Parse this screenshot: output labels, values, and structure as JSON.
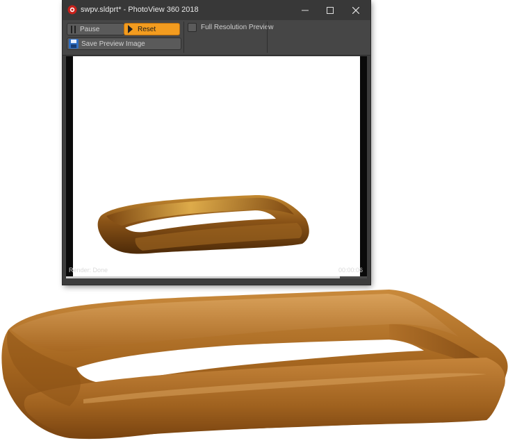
{
  "window": {
    "title": "swpv.sldprt* - PhotoView 360 2018",
    "icon": "photoview-app-icon",
    "controls": {
      "minimize": "minimize-icon",
      "maximize": "maximize-icon",
      "close": "close-icon"
    }
  },
  "toolbar": {
    "pause_label": "Pause",
    "reset_label": "Reset",
    "save_label": "Save Preview Image",
    "full_res_label": "Full Resolution Preview",
    "full_res_checked": false,
    "colors": {
      "reset_accent": "#f39c1f",
      "toolbar_bg": "#464646"
    }
  },
  "viewport": {
    "status_left": "Render: Done",
    "status_right": "00:00:06",
    "progress_fraction": 0.91,
    "background": "#ffffff"
  },
  "model": {
    "color_main": "#a5661f",
    "color_dark": "#6b3c0d",
    "color_light": "#d3983f"
  }
}
